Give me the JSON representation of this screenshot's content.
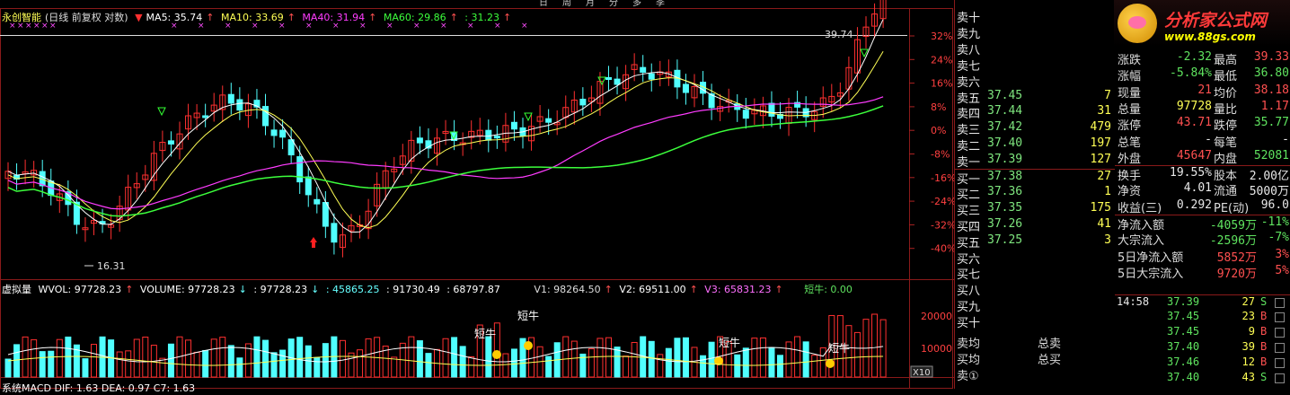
{
  "top_menu_items": [
    "日",
    "周",
    "月",
    "分",
    "多",
    "季"
  ],
  "header": {
    "stock_name": "永创智能",
    "mode": "(日线 前复权 对数)",
    "ma5": "MA5: 35.74",
    "ma10": "MA10: 33.69",
    "ma40": "MA40: 31.94",
    "ma60": "MA60: 29.86",
    "extra": ": 31.23",
    "colors": {
      "ma5": "#ffffff",
      "ma10": "#ffff55",
      "ma40": "#ff3cff",
      "ma60": "#3cff3c"
    }
  },
  "price_axis": [
    "32%",
    "24%",
    "16%",
    "8%",
    "0%",
    "-8%",
    "-16%",
    "-24%",
    "-32%",
    "-40%"
  ],
  "price_annotations": {
    "high": "39.74",
    "low": "16.31"
  },
  "volume_header": {
    "title": "虚拟量",
    "wvol": "WVOL: 97728.23",
    "volume": "VOLUME: 97728.23",
    "v_a": ": 97728.23",
    "v_b": ": 45865.25",
    "v_c": ": 91730.49",
    "v_d": ": 68797.87",
    "v1": "V1: 98264.50",
    "v2": "V2: 69511.00",
    "v3": "V3: 65831.23",
    "short_bull": "短牛: 0.00"
  },
  "volume_axis": [
    "20000",
    "10000"
  ],
  "volume_unit": "X10",
  "short_bull_label": "短牛",
  "macd_header": "系统MACD  DIF: 1.63   DEA: 0.97   C7: 1.63",
  "order_book": {
    "sells": [
      {
        "label": "卖十",
        "price": "",
        "vol": ""
      },
      {
        "label": "卖九",
        "price": "",
        "vol": ""
      },
      {
        "label": "卖八",
        "price": "",
        "vol": ""
      },
      {
        "label": "卖七",
        "price": "",
        "vol": ""
      },
      {
        "label": "卖六",
        "price": "",
        "vol": ""
      },
      {
        "label": "卖五",
        "price": "37.45",
        "vol": "7"
      },
      {
        "label": "卖四",
        "price": "37.44",
        "vol": "31"
      },
      {
        "label": "卖三",
        "price": "37.42",
        "vol": "479"
      },
      {
        "label": "卖二",
        "price": "37.40",
        "vol": "197"
      },
      {
        "label": "卖一",
        "price": "37.39",
        "vol": "127"
      }
    ],
    "buys": [
      {
        "label": "买一",
        "price": "37.38",
        "vol": "27"
      },
      {
        "label": "买二",
        "price": "37.36",
        "vol": "1"
      },
      {
        "label": "买三",
        "price": "37.35",
        "vol": "175"
      },
      {
        "label": "买四",
        "price": "37.26",
        "vol": "41"
      },
      {
        "label": "买五",
        "price": "37.25",
        "vol": "3"
      },
      {
        "label": "买六",
        "price": "",
        "vol": ""
      },
      {
        "label": "买七",
        "price": "",
        "vol": ""
      },
      {
        "label": "买八",
        "price": "",
        "vol": ""
      },
      {
        "label": "买九",
        "price": "",
        "vol": ""
      },
      {
        "label": "买十",
        "price": "",
        "vol": ""
      }
    ],
    "avg_sell": "卖均",
    "avg_buy": "买均",
    "total_sell": "总卖",
    "total_buy": "总买",
    "sell_one": "卖①"
  },
  "stats": [
    {
      "l1": "涨跌",
      "v1": "-2.32",
      "c1": "green",
      "l2": "最高",
      "v2": "39.33",
      "c2": "red"
    },
    {
      "l1": "涨幅",
      "v1": "-5.84%",
      "c1": "green",
      "l2": "最低",
      "v2": "36.80",
      "c2": "green"
    },
    {
      "l1": "现量",
      "v1": "21",
      "c1": "red",
      "l2": "均价",
      "v2": "38.18",
      "c2": "red"
    },
    {
      "l1": "总量",
      "v1": "97728",
      "c1": "yellow",
      "l2": "量比",
      "v2": "1.17",
      "c2": "red"
    },
    {
      "l1": "涨停",
      "v1": "43.71",
      "c1": "red",
      "l2": "跌停",
      "v2": "35.77",
      "c2": "green"
    },
    {
      "l1": "总笔",
      "v1": "-",
      "c1": "white",
      "l2": "每笔",
      "v2": "-",
      "c2": "white"
    },
    {
      "l1": "外盘",
      "v1": "45647",
      "c1": "red",
      "l2": "内盘",
      "v2": "52081",
      "c2": "green"
    },
    {
      "l1": "换手",
      "v1": "19.55%",
      "c1": "white",
      "l2": "股本",
      "v2": "2.00亿",
      "c2": "white"
    },
    {
      "l1": "净资",
      "v1": "4.01",
      "c1": "white",
      "l2": "流通",
      "v2": "5000万",
      "c2": "white"
    },
    {
      "l1": "收益(三)",
      "v1": "0.292",
      "c1": "white",
      "l2": "PE(动)",
      "v2": "96.0",
      "c2": "white"
    },
    {
      "l1": "净流入额",
      "v1": "-4059万",
      "c1": "green",
      "l2": "",
      "v2": "-11%",
      "c2": "green"
    },
    {
      "l1": "大宗流入",
      "v1": "-2596万",
      "c1": "green",
      "l2": "",
      "v2": "-7%",
      "c2": "green"
    },
    {
      "l1": "5日净流入额",
      "v1": "5852万",
      "c1": "red",
      "l2": "",
      "v2": "3%",
      "c2": "red"
    },
    {
      "l1": "5日大宗流入",
      "v1": "9720万",
      "c1": "red",
      "l2": "",
      "v2": "5%",
      "c2": "red"
    }
  ],
  "ticks": [
    {
      "time": "14:58",
      "price": "37.39",
      "vol": "27",
      "side": "S"
    },
    {
      "time": "",
      "price": "37.45",
      "vol": "23",
      "side": "B"
    },
    {
      "time": "",
      "price": "37.45",
      "vol": "9",
      "side": "B"
    },
    {
      "time": "",
      "price": "37.40",
      "vol": "39",
      "side": "B"
    },
    {
      "time": "",
      "price": "37.46",
      "vol": "12",
      "side": "B"
    },
    {
      "time": "",
      "price": "37.40",
      "vol": "43",
      "side": "S"
    }
  ],
  "logo": {
    "title": "分析家公式网",
    "url": "www.88gs.com"
  }
}
